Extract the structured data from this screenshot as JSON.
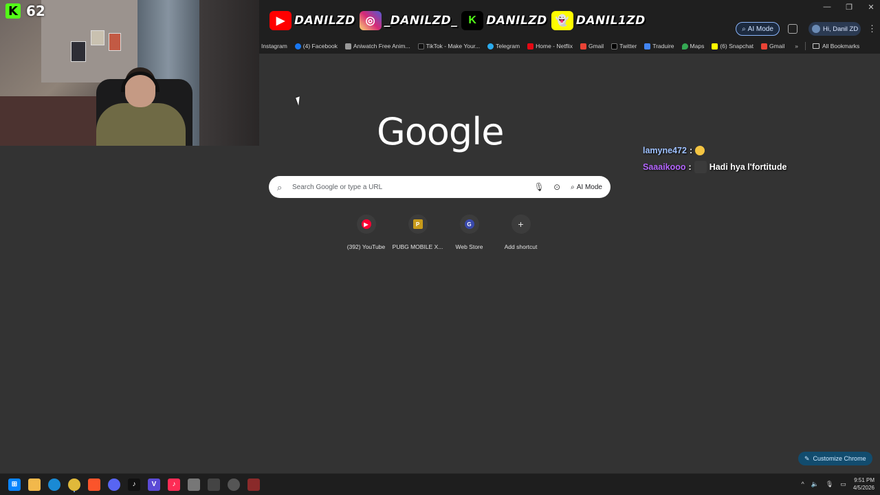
{
  "webcam": {
    "kick_viewers": "62"
  },
  "socials": [
    {
      "platform": "youtube",
      "icon": "youtube-icon",
      "name": "DANILZD"
    },
    {
      "platform": "instagram",
      "icon": "instagram-icon",
      "name": "_DANILZD_"
    },
    {
      "platform": "kick",
      "icon": "kick-icon",
      "name": "DANILZD"
    },
    {
      "platform": "snapchat",
      "icon": "snapchat-icon",
      "name": "DANIL1ZD"
    }
  ],
  "browser": {
    "ai_mode_label": "AI Mode",
    "profile_label": "Hi, Danil ZD",
    "bookmarks": [
      {
        "label": "Instagram",
        "color": ""
      },
      {
        "label": "(4) Facebook",
        "color": "#1877f2"
      },
      {
        "label": "Aniwatch Free Anim...",
        "color": "#999999"
      },
      {
        "label": "TikTok - Make Your...",
        "color": "#111111"
      },
      {
        "label": "Telegram",
        "color": "#2aabee"
      },
      {
        "label": "Home - Netflix",
        "color": "#e50914"
      },
      {
        "label": "Gmail",
        "color": "#ea4335"
      },
      {
        "label": "Twitter",
        "color": "#000000"
      },
      {
        "label": "Traduire",
        "color": "#4285f4"
      },
      {
        "label": "Maps",
        "color": "#34a853"
      },
      {
        "label": "(6) Snapchat",
        "color": "#fffc00"
      },
      {
        "label": "Gmail",
        "color": "#ea4335"
      }
    ],
    "all_bookmarks_label": "All Bookmarks"
  },
  "newtab": {
    "logo_text": "Google",
    "search_placeholder": "Search Google or type a URL",
    "ai_mode_label": "AI Mode",
    "shortcuts": [
      {
        "label": "(392) YouTube",
        "color": "#ff0033",
        "glyph": "▶"
      },
      {
        "label": "PUBG MOBILE X...",
        "color": "#c79a1a",
        "glyph": "P"
      },
      {
        "label": "Web Store",
        "color": "#3949ab",
        "glyph": "G"
      },
      {
        "label": "Add shortcut",
        "color": "",
        "glyph": "+"
      }
    ],
    "customize_label": "Customize Chrome"
  },
  "chat": [
    {
      "user": "lamyne472",
      "sep": ":",
      "message": ""
    },
    {
      "user": "Saaaikooo",
      "sep": ":",
      "message": "Hadi hya l'fortitude"
    }
  ],
  "taskbar": {
    "time": "9:51 PM",
    "date": "4/5/2026"
  }
}
